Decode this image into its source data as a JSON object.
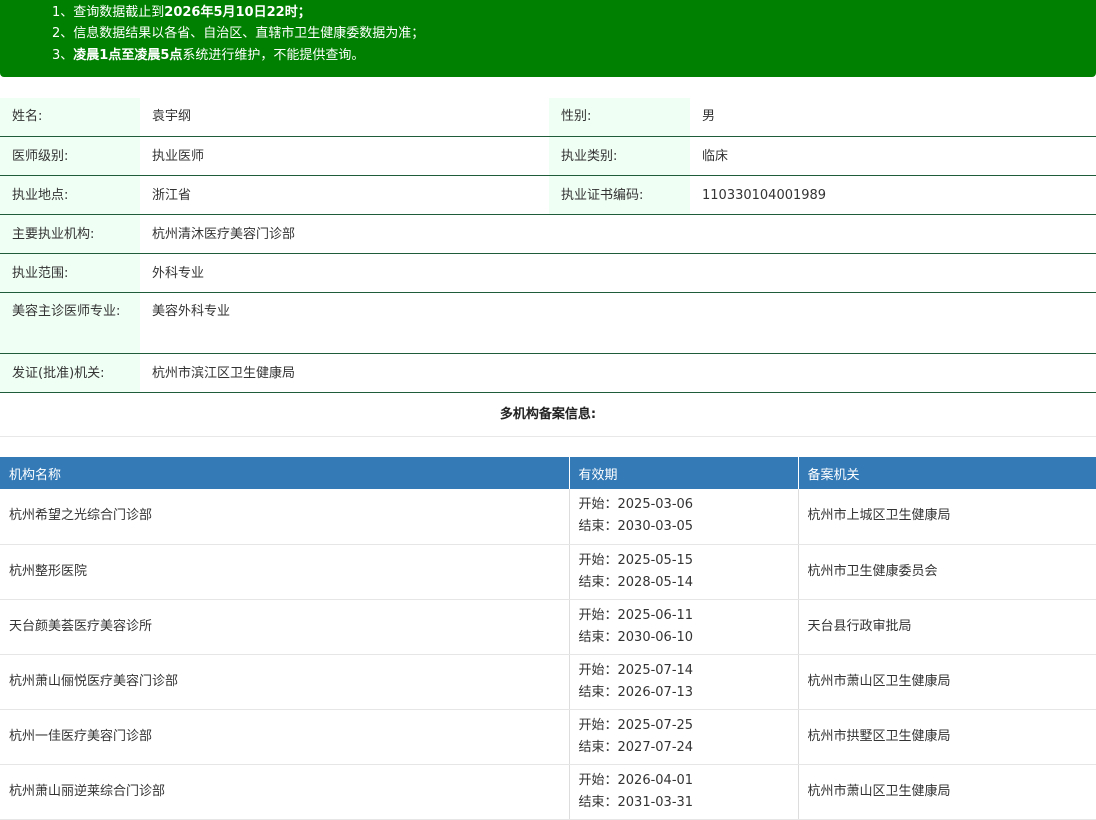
{
  "notice": {
    "line1_prefix": "1、查询数据截止到",
    "line1_bold": "2026年5月10日22时",
    "line1_suffix": "；",
    "line2": "2、信息数据结果以各省、自治区、直辖市卫生健康委数据为准；",
    "line3_prefix": "3、",
    "line3_bold": "凌晨1点至凌晨5点",
    "line3_suffix": "系统进行维护，不能提供查询。",
    "background_color": "#008000"
  },
  "doctor": {
    "name_label": "姓名:",
    "name_value": "袁宇纲",
    "gender_label": "性别:",
    "gender_value": "男",
    "level_label": "医师级别:",
    "level_value": "执业医师",
    "category_label": "执业类别:",
    "category_value": "临床",
    "location_label": "执业地点:",
    "location_value": "浙江省",
    "cert_label": "执业证书编码:",
    "cert_value": "110330104001989",
    "institution_label": "主要执业机构:",
    "institution_value": "杭州清沐医疗美容门诊部",
    "scope_label": "执业范围:",
    "scope_value": "外科专业",
    "cosmetic_label": "美容主诊医师专业:",
    "cosmetic_value": "美容外科专业",
    "issuer_label": "发证(批准)机关:",
    "issuer_value": "杭州市滨江区卫生健康局"
  },
  "multi_title": "多机构备案信息:",
  "institutions": {
    "headers": [
      "机构名称",
      "有效期",
      "备案机关"
    ],
    "header_color": "#337ab7",
    "rows": [
      {
        "name": "杭州希望之光综合门诊部",
        "start": "开始：2025-03-06",
        "end": "结束：2030-03-05",
        "authority": "杭州市上城区卫生健康局"
      },
      {
        "name": "杭州整形医院",
        "start": "开始：2025-05-15",
        "end": "结束：2028-05-14",
        "authority": "杭州市卫生健康委员会"
      },
      {
        "name": "天台颜美荟医疗美容诊所",
        "start": "开始：2025-06-11",
        "end": "结束：2030-06-10",
        "authority": "天台县行政审批局"
      },
      {
        "name": "杭州萧山俪悦医疗美容门诊部",
        "start": "开始：2025-07-14",
        "end": "结束：2026-07-13",
        "authority": "杭州市萧山区卫生健康局"
      },
      {
        "name": "杭州一佳医疗美容门诊部",
        "start": "开始：2025-07-25",
        "end": "结束：2027-07-24",
        "authority": "杭州市拱墅区卫生健康局"
      },
      {
        "name": "杭州萧山丽逆莱综合门诊部",
        "start": "开始：2026-04-01",
        "end": "结束：2031-03-31",
        "authority": "杭州市萧山区卫生健康局"
      }
    ]
  }
}
